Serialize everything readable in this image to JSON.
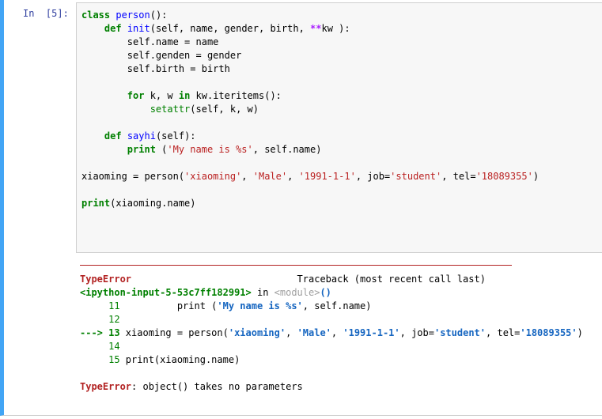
{
  "cell": {
    "prompt": "In  [5]:",
    "code": {
      "l1": {
        "kw": "class",
        "name": "person",
        "rest": "():"
      },
      "l2": {
        "kw": "def",
        "name": "init",
        "rest": "(self, name, gender, birth, ",
        "op": "**",
        "rest2": "kw ):"
      },
      "l3": "self.name = name",
      "l4": "self.genden = gender",
      "l5": "self.birth = birth",
      "l6": {
        "kw": "for",
        "mid": " k, w ",
        "kw2": "in",
        "rest": " kw.iteritems():"
      },
      "l7": {
        "builtin": "setattr",
        "rest": "(self, k, w)"
      },
      "l8": {
        "kw": "def",
        "name": "sayhi",
        "rest": "(self):"
      },
      "l9": {
        "kw": "print",
        "pre": " (",
        "str": "'My name is %s'",
        "rest": ", self.name)"
      },
      "l10": {
        "pre": "xiaoming = person(",
        "s1": "'xiaoming'",
        "c1": ", ",
        "s2": "'Male'",
        "c2": ", ",
        "s3": "'1991-1-1'",
        "c3": ", job=",
        "s4": "'student'",
        "c4": ", tel=",
        "s5": "'18089355'",
        "end": ")"
      },
      "l11": {
        "kw": "print",
        "rest": "(xiaoming.name)"
      }
    }
  },
  "output": {
    "error_type": "TypeError",
    "traceback_label": "Traceback (most recent call last)",
    "input_ref": "<ipython-input-5-53c7ff182991>",
    "in_word": " in ",
    "module": "<module>",
    "module_parens": "()",
    "tb": {
      "n11": "11",
      "l11_pre": "          print (",
      "l11_str": "'My name is %s'",
      "l11_rest": ", self.name)",
      "n12": "12",
      "arrow": "---> ",
      "n13": "13",
      "l13_pre": " xiaoming = person(",
      "l13_s1": "'xiaoming'",
      "l13_c1": ", ",
      "l13_s2": "'Male'",
      "l13_c2": ", ",
      "l13_s3": "'1991-1-1'",
      "l13_c3": ", job=",
      "l13_s4": "'student'",
      "l13_c4": ", tel=",
      "l13_s5": "'18089355'",
      "l13_end": ")",
      "n14": "14",
      "n15": "15",
      "l15": " print(xiaoming.name)"
    },
    "final_error": "TypeError",
    "final_msg": ": object() takes no parameters"
  }
}
